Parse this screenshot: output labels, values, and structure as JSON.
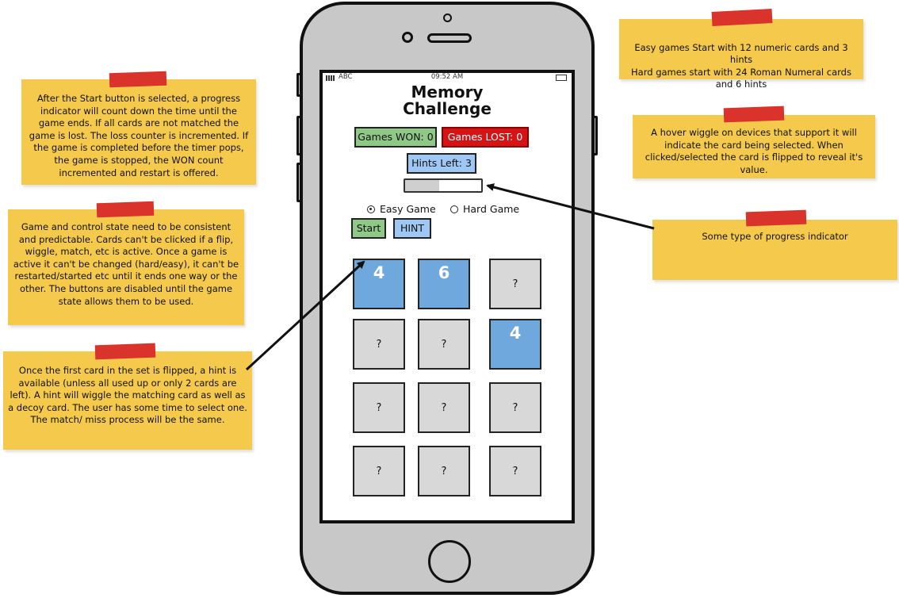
{
  "notes": {
    "progress_rules": "After the Start button is selected, a progress indicator will count down the time until the game ends.  If all cards are not matched the game is lost.  The loss counter is incremented.  If the game is completed before the timer pops, the game is stopped, the WON count incremented and restart is offered.",
    "state_rules": "Game and control state need to be consistent and predictable.  Cards can't be clicked if a flip, wiggle, match, etc is active.  Once a game is active it can't be changed (hard/easy), it can't be restarted/started etc until it ends one way or the other.  The buttons are disabled until the game state allows them to be used.",
    "hint_rules": "Once the first card in the set is flipped, a hint is available (unless all used up or only 2 cards are left).  A hint will wiggle the matching card as well as a decoy card.  The user has some time to select one.  The match/ miss process will be the same.",
    "difficulty": "Easy games Start with 12 numeric cards and 3 hints\nHard games start with 24 Roman Numeral cards and 6 hints",
    "hover": "A hover wiggle on devices that support it will indicate the card being selected.  When clicked/selected the card is flipped to reveal it's value.",
    "progress_indicator": "Some type of progress indicator"
  },
  "phone": {
    "carrier": "ABC",
    "time": "09:52 AM"
  },
  "app": {
    "title": "Memory Challenge",
    "games_won": "Games WON: 0",
    "games_lost": "Games LOST: 0",
    "hints_left": "Hints Left: 3",
    "progress_fraction": 0.45,
    "easy_label": "Easy Game",
    "hard_label": "Hard Game",
    "selected_mode": "easy",
    "start_label": "Start",
    "hint_label": "HINT"
  },
  "cards": [
    "4",
    "6",
    "?",
    "?",
    "?",
    "4",
    "?",
    "?",
    "?",
    "?",
    "?",
    "?"
  ],
  "colors": {
    "note": "#f4c94c",
    "tape": "#d9332b",
    "card_face_up": "#6fa8dc",
    "card_face_down": "#d8d8d8",
    "won": "#8fc887",
    "lost": "#d51515",
    "hints": "#9fc7f3"
  }
}
